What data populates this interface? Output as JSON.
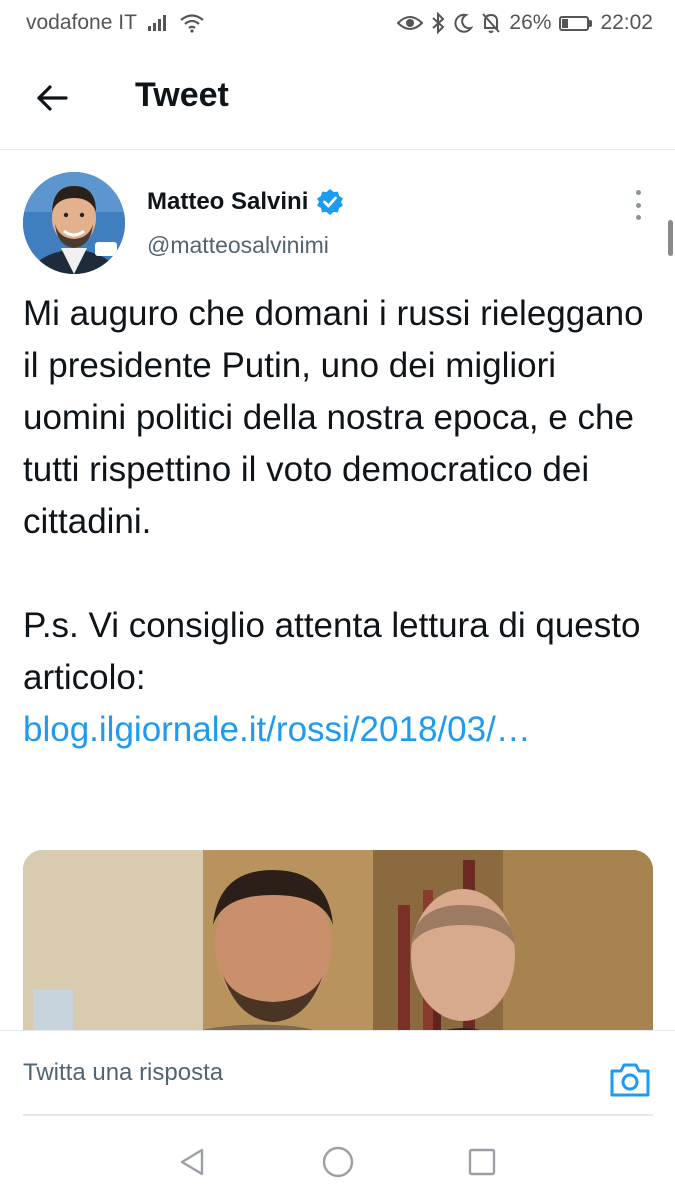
{
  "status_bar": {
    "carrier": "vodafone IT",
    "battery_percent_label": "26%",
    "battery_level": 0.26,
    "time": "22:02",
    "icons": [
      "signal-icon",
      "wifi-icon",
      "eye-icon",
      "bluetooth-icon",
      "moon-icon",
      "bell-off-icon",
      "battery-icon"
    ]
  },
  "header": {
    "title": "Tweet",
    "back_icon": "arrow-left-icon"
  },
  "tweet": {
    "author_name": "Matteo Salvini",
    "verified": true,
    "author_handle": "@matteosalvinimi",
    "text_main": "Mi auguro che domani i russi rieleggano il presidente Putin, uno dei migliori uomini politici della nostra epoca, e che tutti rispettino il voto democratico dei cittadini.\n\nP.s. Vi consiglio attenta lettura di questo articolo: ",
    "link_text": "blog.ilgiornale.it/rossi/2018/03/…"
  },
  "reply": {
    "placeholder": "Twitta una risposta",
    "camera_icon": "camera-icon"
  },
  "nav_bar": {
    "icons": [
      "back-triangle-icon",
      "home-circle-icon",
      "recents-square-icon"
    ]
  },
  "colors": {
    "accent": "#1d9bf0",
    "text": "#0f1419",
    "secondary_text": "#536471",
    "status_text": "#555555"
  }
}
